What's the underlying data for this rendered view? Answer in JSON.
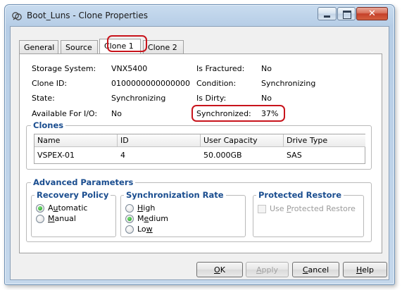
{
  "window": {
    "title": "Boot_Luns - Clone Properties"
  },
  "tabs": [
    {
      "label": "General"
    },
    {
      "label": "Source"
    },
    {
      "label": "Clone 1"
    },
    {
      "label": "Clone 2"
    }
  ],
  "properties": {
    "storage_system_label": "Storage System:",
    "storage_system_value": "VNX5400",
    "clone_id_label": "Clone ID:",
    "clone_id_value": "0100000000000000",
    "state_label": "State:",
    "state_value": "Synchronizing",
    "available_label": "Available For I/O:",
    "available_value": "No",
    "is_fractured_label": "Is Fractured:",
    "is_fractured_value": "No",
    "condition_label": "Condition:",
    "condition_value": "Synchronizing",
    "is_dirty_label": "Is Dirty:",
    "is_dirty_value": "No",
    "synchronized_label": "Synchronized:",
    "synchronized_value": "37%"
  },
  "clones": {
    "title": "Clones",
    "columns": [
      "Name",
      "ID",
      "User Capacity",
      "Drive Type"
    ],
    "rows": [
      [
        "VSPEX-01",
        "4",
        "50.000GB",
        "SAS"
      ]
    ]
  },
  "advanced": {
    "title": "Advanced Parameters",
    "recovery_policy": {
      "title": "Recovery Policy",
      "options": [
        {
          "pre": "A",
          "u": "u",
          "post": "tomatic",
          "checked": true
        },
        {
          "pre": "",
          "u": "M",
          "post": "anual",
          "checked": false
        }
      ]
    },
    "sync_rate": {
      "title": "Synchronization Rate",
      "options": [
        {
          "pre": "",
          "u": "H",
          "post": "igh",
          "checked": false
        },
        {
          "pre": "M",
          "u": "e",
          "post": "dium",
          "checked": true
        },
        {
          "pre": "Lo",
          "u": "w",
          "post": "",
          "checked": false
        }
      ]
    },
    "protected_restore": {
      "title": "Protected Restore",
      "checkbox": {
        "pre": "Use ",
        "u": "P",
        "post": "rotected Restore",
        "checked": false
      }
    }
  },
  "buttons": {
    "ok": {
      "pre": "",
      "u": "O",
      "post": "K"
    },
    "apply": {
      "pre": "",
      "u": "A",
      "post": "pply"
    },
    "cancel": {
      "pre": "",
      "u": "C",
      "post": "ancel"
    },
    "help": {
      "pre": "",
      "u": "H",
      "post": "elp"
    }
  },
  "colors": {
    "highlight": "#c8141c",
    "group_title": "#1a4d8f",
    "radio_checked": "#139a13"
  }
}
